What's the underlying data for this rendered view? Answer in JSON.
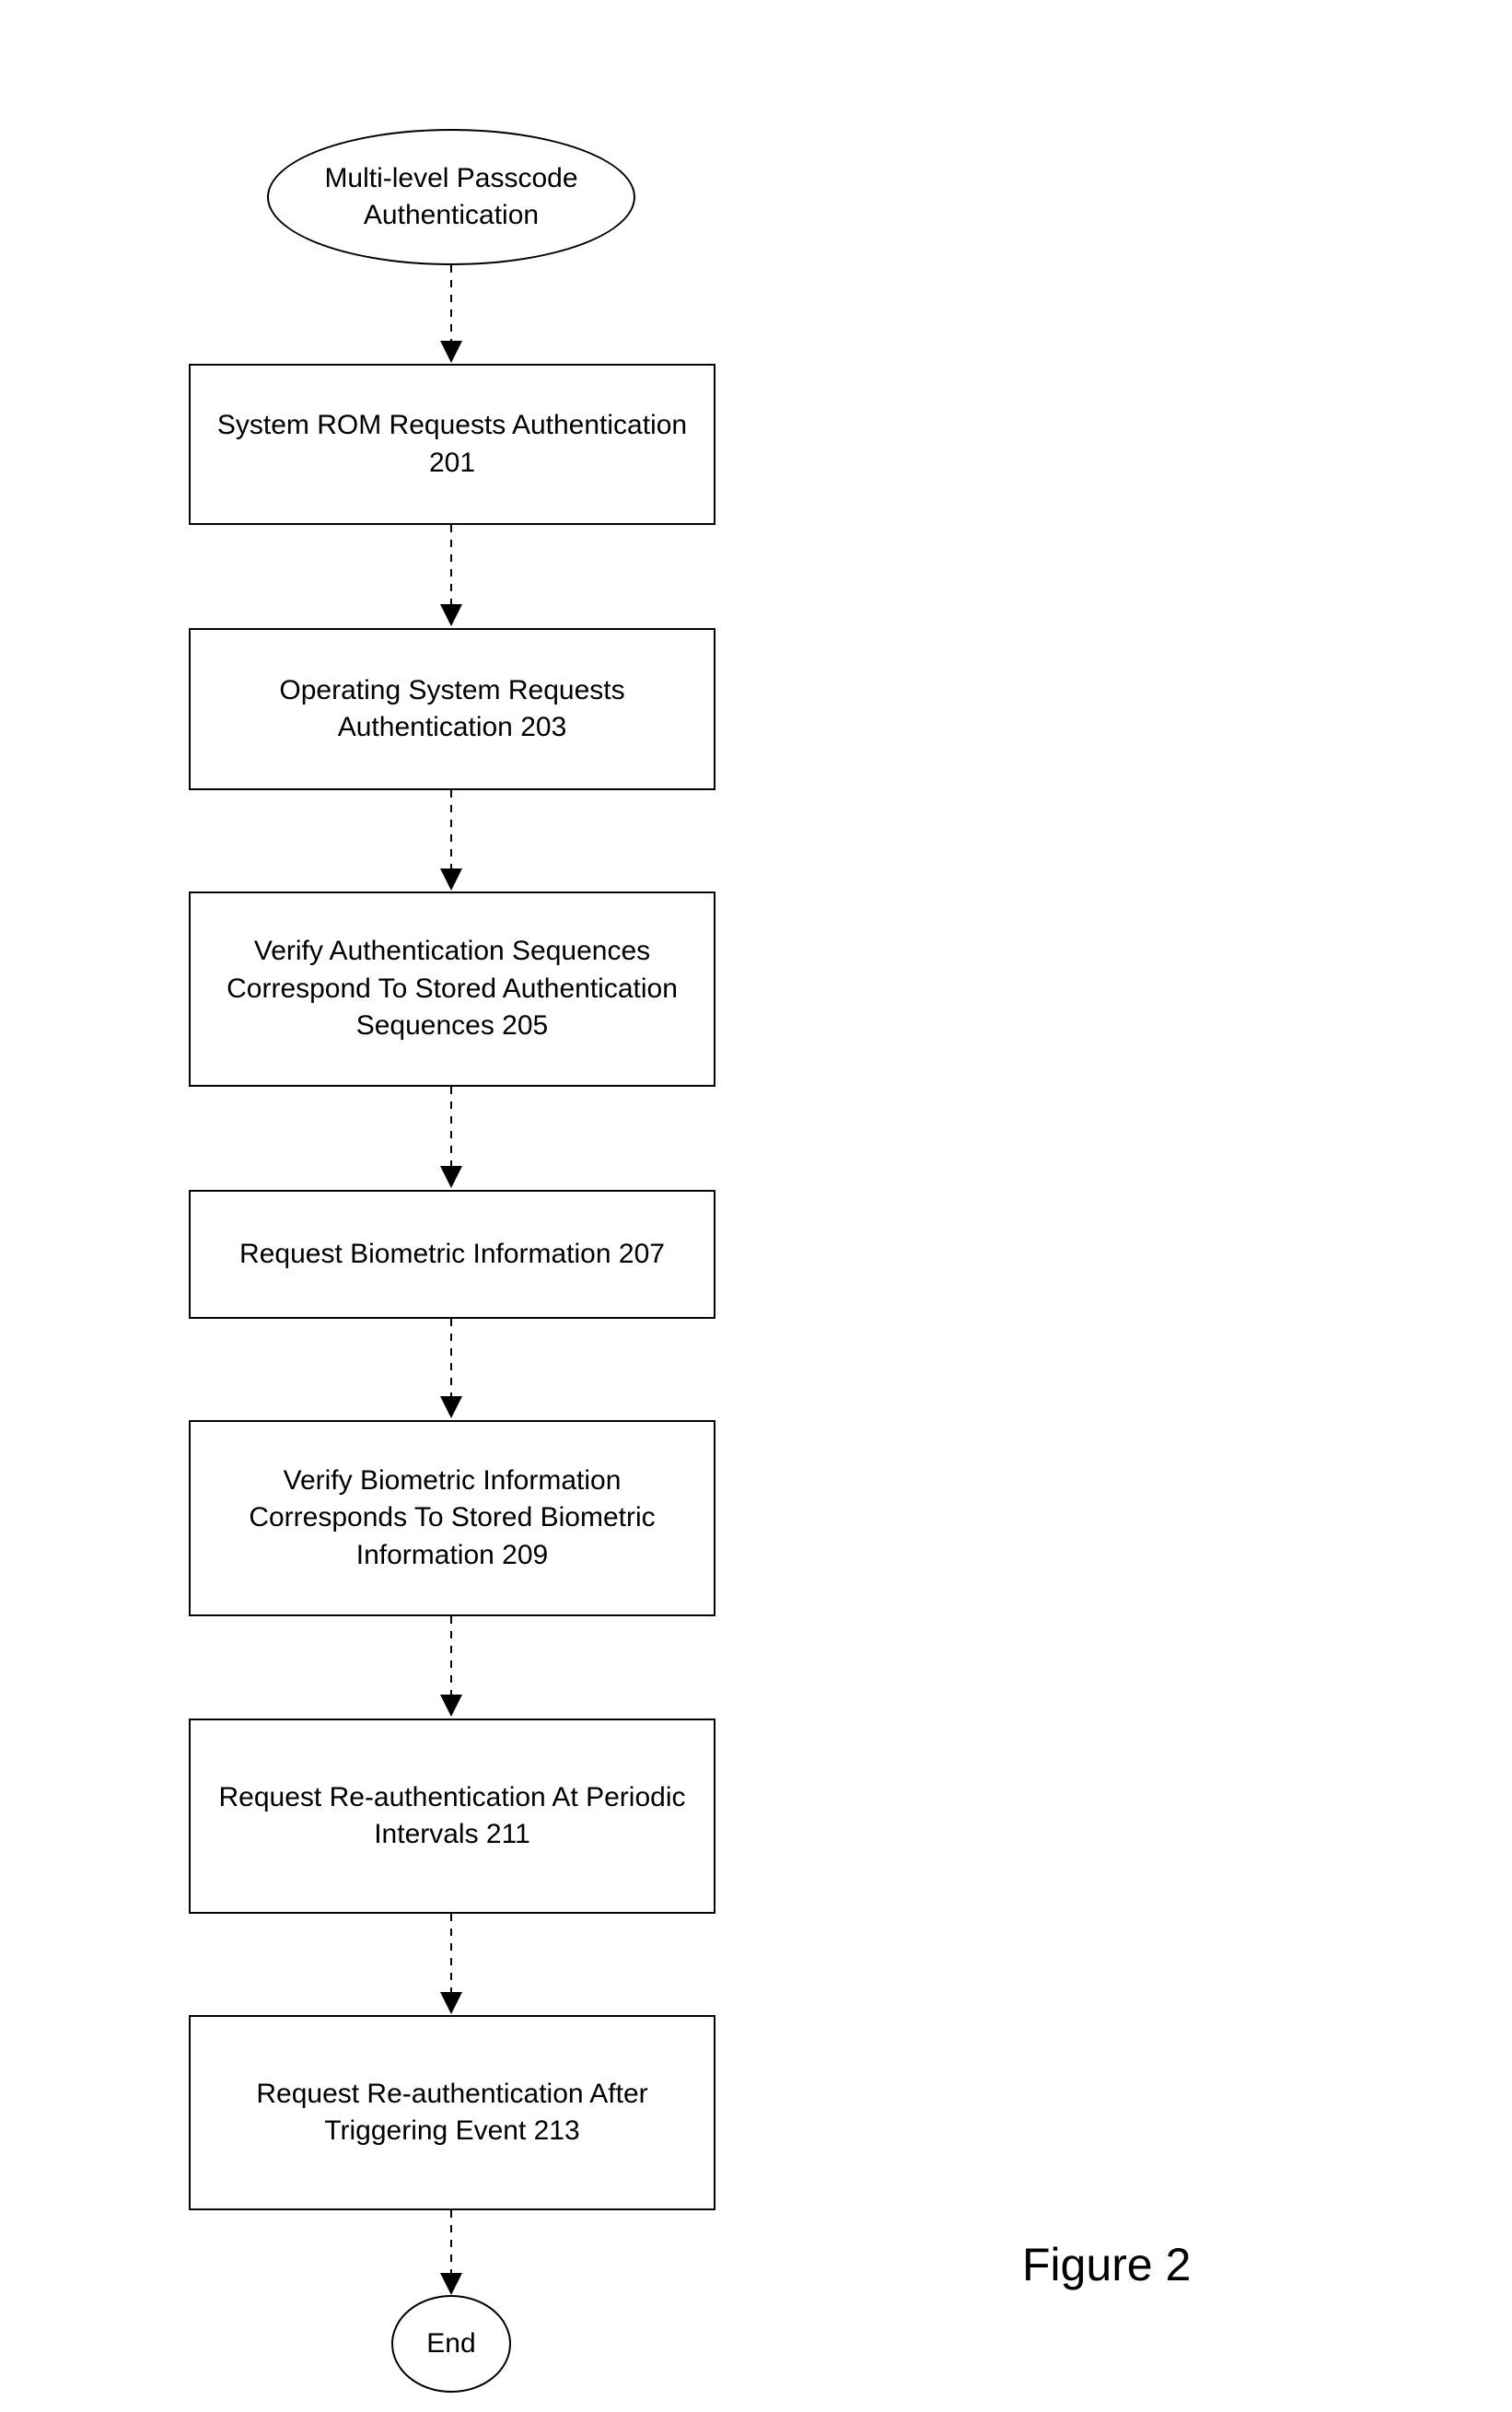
{
  "chart_data": {
    "type": "flowchart",
    "title": "Multi-level Passcode Authentication",
    "nodes": [
      {
        "id": "start",
        "shape": "ellipse",
        "label": "Multi-level Passcode Authentication"
      },
      {
        "id": "n201",
        "shape": "rect",
        "label": "System ROM Requests Authentication 201"
      },
      {
        "id": "n203",
        "shape": "rect",
        "label": "Operating System Requests Authentication 203"
      },
      {
        "id": "n205",
        "shape": "rect",
        "label": "Verify Authentication Sequences Correspond To Stored Authentication Sequences 205"
      },
      {
        "id": "n207",
        "shape": "rect",
        "label": "Request Biometric Information 207"
      },
      {
        "id": "n209",
        "shape": "rect",
        "label": "Verify Biometric Information Corresponds To Stored Biometric Information 209"
      },
      {
        "id": "n211",
        "shape": "rect",
        "label": "Request Re-authentication At Periodic Intervals 211"
      },
      {
        "id": "n213",
        "shape": "rect",
        "label": "Request Re-authentication After Triggering Event 213"
      },
      {
        "id": "end",
        "shape": "ellipse",
        "label": "End"
      }
    ],
    "edges": [
      [
        "start",
        "n201"
      ],
      [
        "n201",
        "n203"
      ],
      [
        "n203",
        "n205"
      ],
      [
        "n205",
        "n207"
      ],
      [
        "n207",
        "n209"
      ],
      [
        "n209",
        "n211"
      ],
      [
        "n211",
        "n213"
      ],
      [
        "n213",
        "end"
      ]
    ],
    "figure_label": "Figure 2"
  },
  "nodes": {
    "start": "Multi-level Passcode\nAuthentication",
    "n201": "System ROM Requests Authentication\n201",
    "n203": "Operating System Requests\nAuthentication 203",
    "n205": "Verify Authentication Sequences\nCorrespond To Stored Authentication\nSequences 205",
    "n207": "Request Biometric Information 207",
    "n209": "Verify Biometric Information\nCorresponds To Stored Biometric\nInformation 209",
    "n211": "Request Re-authentication At Periodic\nIntervals 211",
    "n213": "Request Re-authentication After\nTriggering Event 213",
    "end": "End"
  },
  "figure_label": "Figure 2"
}
